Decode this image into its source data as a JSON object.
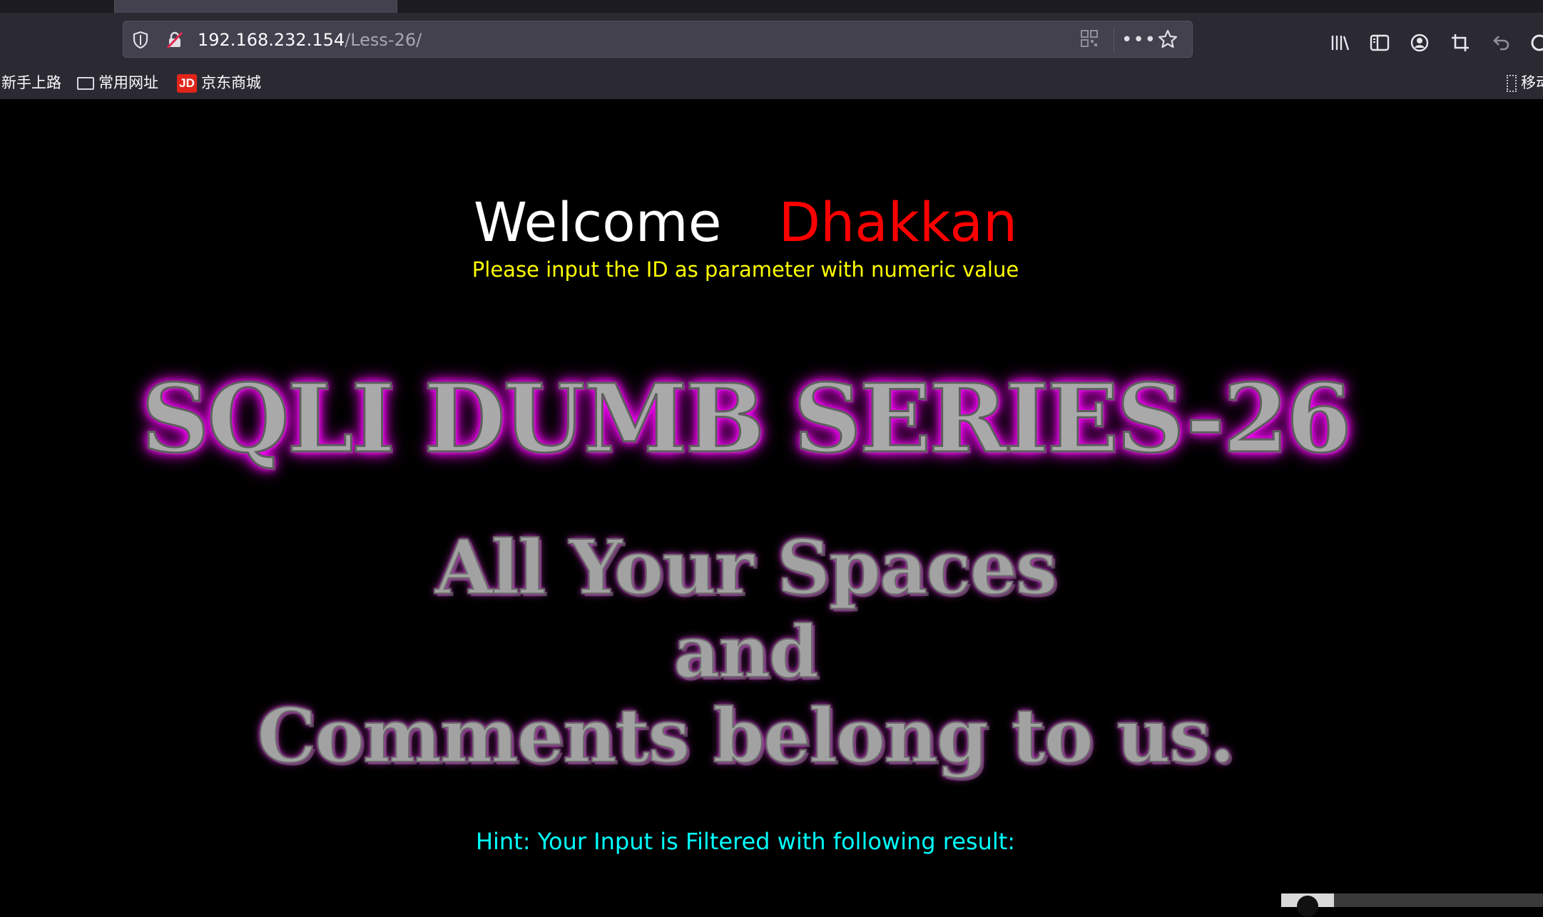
{
  "browser": {
    "address_bar": {
      "host": "192.168.232.154",
      "path": "/Less-26/"
    },
    "bookmarks": [
      {
        "label": "新手上路",
        "icon": "none"
      },
      {
        "label": "常用网址",
        "icon": "folder-icon"
      },
      {
        "label": "京东商城",
        "icon": "jd-icon",
        "icon_text": "JD"
      },
      {
        "label": "移动",
        "icon": "mobile-icon"
      }
    ],
    "toolbar_icons": [
      "library-icon",
      "sidebar-icon",
      "account-icon",
      "screenshot-crop-icon",
      "undo-icon",
      "sync-icon"
    ],
    "url_bar_icons": [
      "shield-icon",
      "insecure-lock-icon",
      "qr-code-icon",
      "more-actions-icon",
      "bookmark-star-icon"
    ]
  },
  "page": {
    "welcome": "Welcome",
    "name": "Dhakkan",
    "instruction": "Please input the ID as parameter with numeric value",
    "banner_title": "SQLI DUMB SERIES-26",
    "slogan": {
      "line1": "All Your Spaces",
      "line2": "and",
      "line3": "Comments belong to us."
    },
    "hint": "Hint: Your Input is Filtered with following result:"
  },
  "colors": {
    "background": "#000000",
    "welcome": "#ffffff",
    "name": "#ff0000",
    "instruction": "#ffff00",
    "hint": "#00ffff",
    "banner_glow": "#ff00ff"
  }
}
